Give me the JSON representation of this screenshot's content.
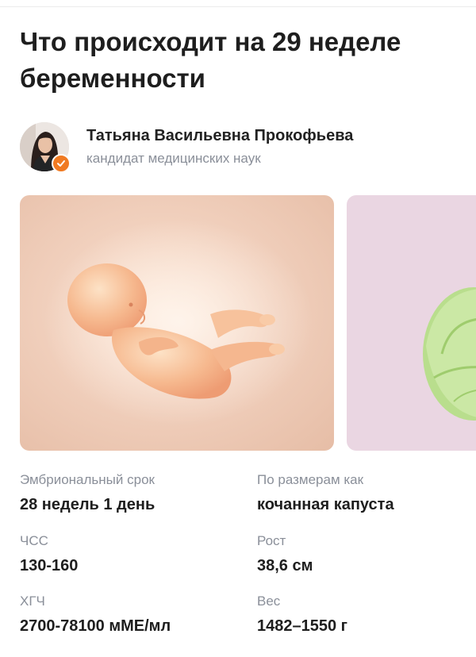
{
  "article": {
    "title": "Что происходит на 29 неделе беременности"
  },
  "author": {
    "name": "Татьяна Васильевна Прокофьева",
    "role": "кандидат медицинских наук",
    "verified_color": "#f07a22"
  },
  "gallery": {
    "items": [
      {
        "icon": "fetus-illustration"
      },
      {
        "icon": "cabbage-image"
      }
    ]
  },
  "facts": {
    "embryonic_term": {
      "label": "Эмбриональный срок",
      "value": "28 недель 1 день"
    },
    "size_like": {
      "label": "По размерам как",
      "value": "кочанная капуста"
    },
    "heart_rate": {
      "label": "ЧСС",
      "value": "130-160"
    },
    "height": {
      "label": "Рост",
      "value": "38,6 см"
    },
    "hcg": {
      "label": "ХГЧ",
      "value": "2700-78100 мМЕ/мл"
    },
    "weight": {
      "label": "Вес",
      "value": "1482–1550 г"
    }
  }
}
